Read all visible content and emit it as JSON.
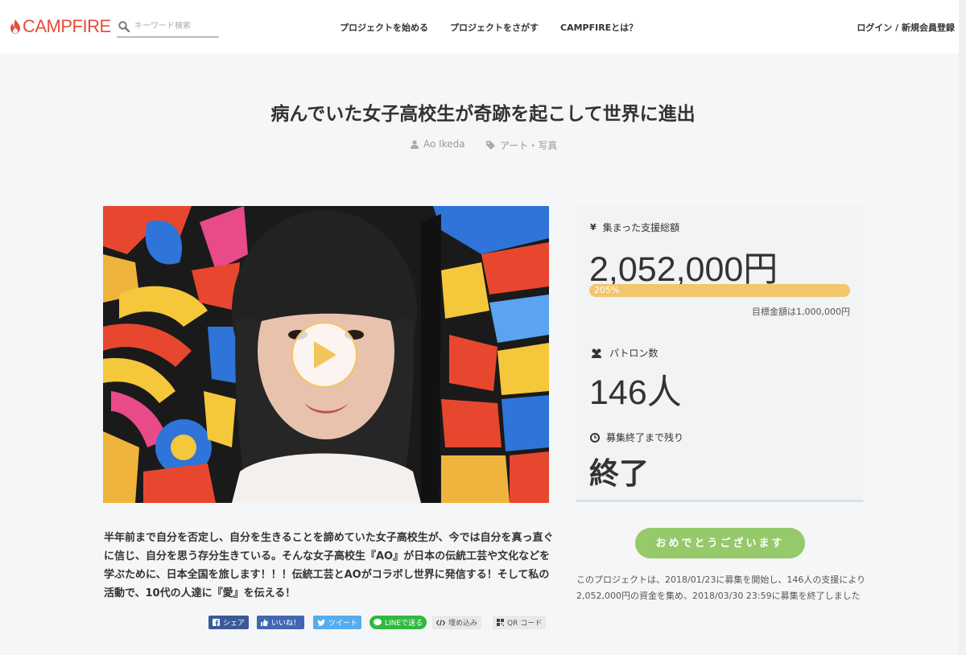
{
  "header": {
    "logo_text": "CAMPFIRE",
    "search_placeholder": "キーワード検索",
    "nav": [
      "プロジェクトを始める",
      "プロジェクトをさがす",
      "CAMPFIREとは？"
    ],
    "login": "ログイン / 新規会員登録"
  },
  "project": {
    "title": "病んでいた女子高校生が奇跡を起こして世界に進出",
    "owner": "Ao Ikeda",
    "category": "アート・写真",
    "description": "半年前まで自分を否定し、自分を生きることを諦めていた女子高校生が、今では自分を真っ直ぐに信じ、自分を思う存分生きている。そんな女子高校生『AO』が日本の伝統工芸や文化などを学ぶために、日本全国を旅します！！！伝統工芸とAOがコラボし世界に発信する！そして私の活動で、10代の人達に『愛』を伝える！"
  },
  "stats": {
    "currency_symbol": "¥",
    "amount_label": "集まった支援総額",
    "amount": "2,052,000円",
    "progress_text": "205%",
    "progress_percent": 205,
    "goal": "目標金額は1,000,000円",
    "patrons_label": "パトロン数",
    "patrons": "146人",
    "remaining_label": "募集終了まで残り",
    "remaining": "終了"
  },
  "congrats_button": "おめでとうございます",
  "summary": "このプロジェクトは、2018/01/23に募集を開始し、146人の支援により2,052,000円の資金を集め、2018/03/30 23:59に募集を終了しました",
  "share": {
    "facebook": "シェア",
    "like": "いいね！",
    "twitter": "ツイート",
    "line": "LINEで送る",
    "embed": "埋め込み",
    "qr": "QR コード"
  },
  "colors": {
    "brand": "#e54d3a",
    "progress": "#f2c76a",
    "congrats": "#95c96a",
    "play_ring": "#f2c45c"
  }
}
